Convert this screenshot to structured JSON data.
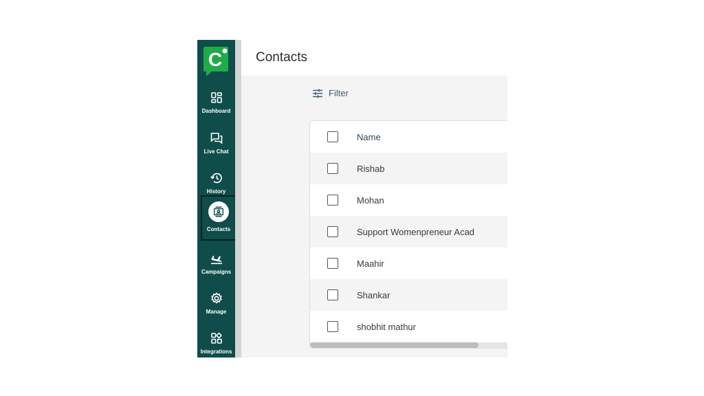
{
  "sidebar": {
    "logo_letter": "C",
    "items": [
      {
        "label": "Dashboard",
        "icon": "dashboard-icon"
      },
      {
        "label": "Live Chat",
        "icon": "chat-icon"
      },
      {
        "label": "History",
        "icon": "history-icon"
      },
      {
        "label": "Contacts",
        "icon": "contacts-icon",
        "active": true
      },
      {
        "label": "Campaigns",
        "icon": "campaign-icon"
      },
      {
        "label": "Manage",
        "icon": "gear-icon"
      },
      {
        "label": "Integrations",
        "icon": "integrations-icon"
      }
    ]
  },
  "main": {
    "title": "Contacts",
    "filter_label": "Filter",
    "table": {
      "header": "Name",
      "rows": [
        "Rishab",
        "Mohan",
        "Support Womenpreneur Acad",
        "Maahir",
        "Shankar",
        "shobhit mathur"
      ]
    }
  },
  "colors": {
    "sidebar_bg": "#0f4d4a",
    "logo_green": "#1fab4a",
    "content_bg": "#f4f4f4"
  }
}
